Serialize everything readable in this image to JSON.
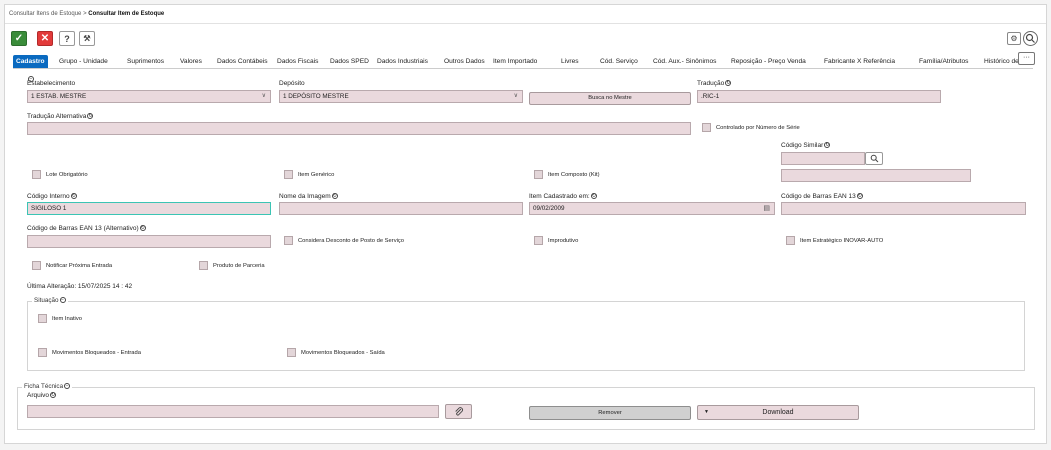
{
  "breadcrumb": {
    "parent": "Consultar Itens de Estoque",
    "sep": ">",
    "current": "Consultar Item de Estoque"
  },
  "toolbar": {
    "ok": "✓",
    "cancel": "✕",
    "help": "?",
    "tools": "🔧"
  },
  "tabs": [
    "Cadastro",
    "Grupo - Unidade",
    "Suprimentos",
    "Valores",
    "Dados Contábeis",
    "Dados Fiscais",
    "Dados SPED",
    "Dados Industriais",
    "Outros Dados",
    "Item Importado",
    "Livres",
    "Cód. Serviço",
    "Cód. Aux.- Sinônimos",
    "Reposição - Preço Venda",
    "Fabricante X Referência",
    "Família/Atributos",
    "Histórico de Alte"
  ],
  "more_tabs": "···",
  "form": {
    "estabelecimento_label": "Estabelecimento",
    "estabelecimento_value": "1 ESTAB. MESTRE",
    "deposito_label": "Depósito",
    "deposito_value": "1 DEPÓSITO MESTRE",
    "busca_button": "Busca no Mestre",
    "traducao_label": "Tradução",
    "traducao_value": ".RIC-1",
    "traducao_alt_label": "Tradução Alternativa",
    "traducao_alt_value": "",
    "controlado_label": "Controlado por Número de Série",
    "codigo_similar_label": "Código Similar",
    "lote_label": "Lote Obrigatório",
    "generico_label": "Item Genérico",
    "composto_label": "Item Composto (Kit)",
    "codigo_interno_label": "Código Interno",
    "codigo_interno_value": "SIGILOSO 1",
    "nome_imagem_label": "Nome da Imagem",
    "nome_imagem_value": "",
    "cadastrado_label": "Item Cadastrado em:",
    "cadastrado_value": "09/02/2009",
    "ean_label": "Código de Barras EAN 13",
    "ean_value": "",
    "ean_alt_label": "Código de Barras EAN 13 (Alternativo)",
    "ean_alt_value": "",
    "desconto_label": "Considera Desconto de Posto de Serviço",
    "improdutivo_label": "Improdutivo",
    "estrategico_label": "Item Estratégico INOVAR-AUTO",
    "notificar_label": "Notificar Próxima Entrada",
    "parceria_label": "Produto de Parceria",
    "ultima_alteracao": "Última Alteração: 15/07/2025 14 : 42"
  },
  "situacao": {
    "legend": "Situação",
    "inativo_label": "Item Inativo",
    "bloq_entrada_label": "Movimentos Bloqueados - Entrada",
    "bloq_saida_label": "Movimentos Bloqueados - Saída"
  },
  "ficha": {
    "legend": "Ficha Técnica",
    "arquivo_label": "Arquivo",
    "arquivo_value": "",
    "remover_button": "Remover",
    "download_button": "Download"
  }
}
